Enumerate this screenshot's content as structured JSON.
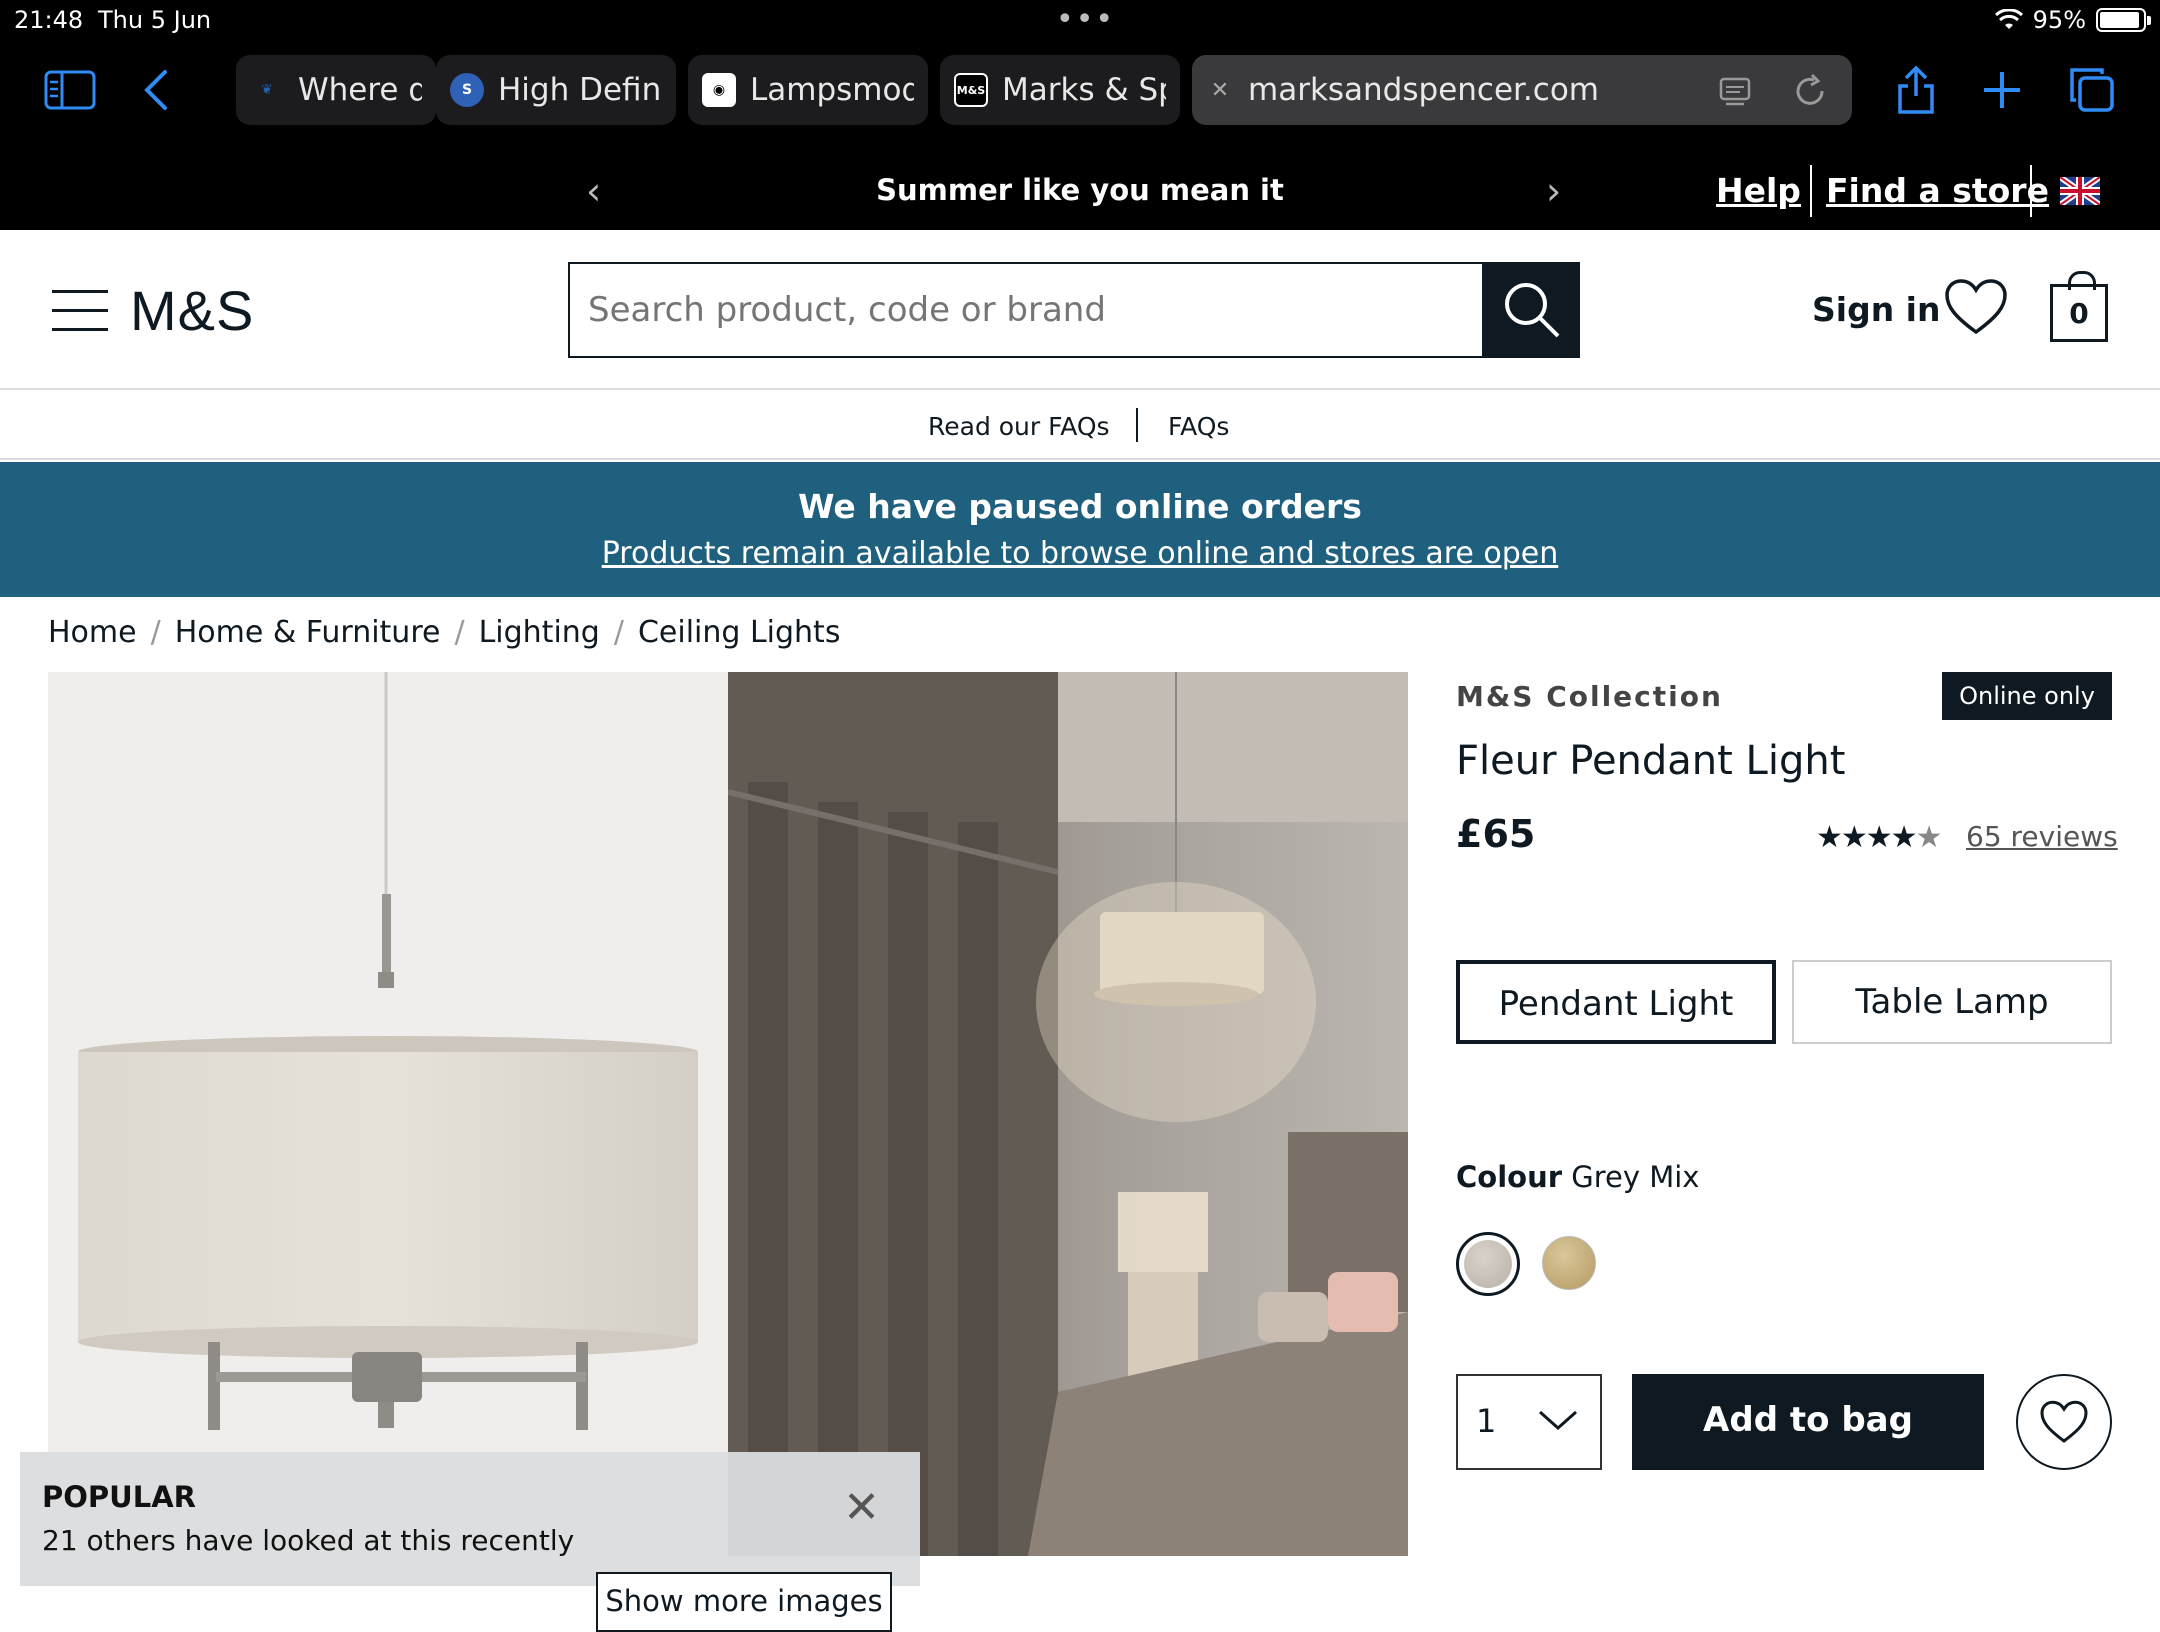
{
  "status": {
    "time": "21:48",
    "date": "Thu 5 Jun",
    "battery": "95%"
  },
  "tabs": [
    {
      "label": "Where dc",
      "favicon": "leaf-icon",
      "color": "#1d5fa8"
    },
    {
      "label": "High Definit",
      "favicon": "s-icon",
      "color": "#2f62b6"
    },
    {
      "label": "Lampsmode",
      "favicon": "lamp-icon",
      "color": "#ffffff"
    },
    {
      "label": "Marks & Spe",
      "favicon": "ms-icon",
      "color": "#000000"
    },
    {
      "label": "marksandspencer.com",
      "favicon": "close-icon",
      "active": true
    }
  ],
  "promo": {
    "message": "Summer like you mean it",
    "help": "Help",
    "find_store": "Find a store"
  },
  "header": {
    "logo": "M&S",
    "search_placeholder": "Search product, code or brand",
    "sign_in": "Sign in",
    "bag_count": "0"
  },
  "faq": {
    "read": "Read our FAQs",
    "faqs": "FAQs"
  },
  "notice": {
    "title": "We have paused online orders",
    "link": "Products remain available to browse online and stores are open"
  },
  "breadcrumb": [
    "Home",
    "Home & Furniture",
    "Lighting",
    "Ceiling Lights"
  ],
  "popup": {
    "title": "POPULAR",
    "text": "21 others have looked at this recently"
  },
  "gallery": {
    "more_button": "Show more images"
  },
  "product": {
    "brand": "M&S Collection",
    "badge": "Online only",
    "name": "Fleur Pendant Light",
    "price": "£65",
    "rating": 4.5,
    "reviews": "65 reviews",
    "options": [
      "Pendant Light",
      "Table Lamp"
    ],
    "colour_label": "Colour",
    "colour_value": "Grey Mix",
    "quantity": "1",
    "add_to_bag": "Add to bag"
  },
  "colors": {
    "brand_dark": "#0f1921",
    "notice_bg": "#20607f",
    "safari_blue": "#2f8cf5"
  }
}
